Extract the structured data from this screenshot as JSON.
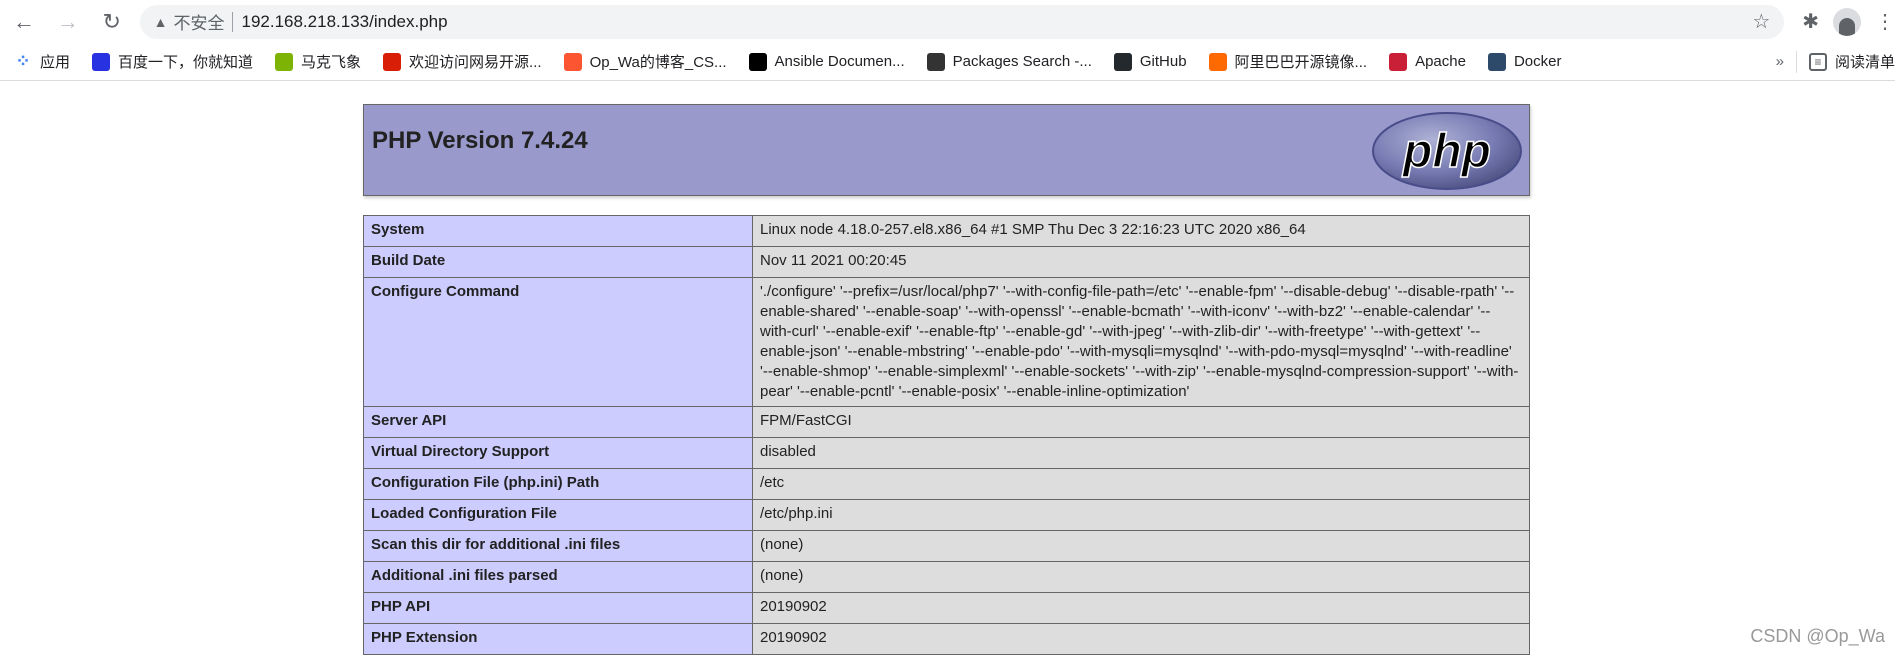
{
  "browser": {
    "url_security": "不安全",
    "url": "192.168.218.133/index.php",
    "bookmarks": [
      {
        "label": "应用",
        "icon": "apps-grid-icon",
        "color": "#4285f4"
      },
      {
        "label": "百度一下，你就知道",
        "icon": "baidu-paw-icon",
        "color": "#2932e1"
      },
      {
        "label": "马克飞象",
        "icon": "maxiang-icon",
        "color": "#7cb305"
      },
      {
        "label": "欢迎访问网易开源...",
        "icon": "netease-icon",
        "color": "#d81e06"
      },
      {
        "label": "Op_Wa的博客_CS...",
        "icon": "csdn-icon",
        "color": "#fc5531"
      },
      {
        "label": "Ansible Documen...",
        "icon": "ansible-icon",
        "color": "#000000"
      },
      {
        "label": "Packages Search -...",
        "icon": "search-icon",
        "color": "#333333"
      },
      {
        "label": "GitHub",
        "icon": "github-icon",
        "color": "#24292e"
      },
      {
        "label": "阿里巴巴开源镜像...",
        "icon": "aliyun-icon",
        "color": "#ff6a00"
      },
      {
        "label": "Apache",
        "icon": "apache-feather-icon",
        "color": "#c92037"
      },
      {
        "label": "Docker",
        "icon": "docker-icon",
        "color": "#2d4a6b"
      }
    ],
    "more": "»",
    "reading_list": "阅读清单"
  },
  "phpinfo": {
    "title": "PHP Version 7.4.24",
    "logo_text": "php",
    "rows": [
      {
        "key": "System",
        "value": "Linux node 4.18.0-257.el8.x86_64 #1 SMP Thu Dec 3 22:16:23 UTC 2020 x86_64"
      },
      {
        "key": "Build Date",
        "value": "Nov 11 2021 00:20:45"
      },
      {
        "key": "Configure Command",
        "value": "'./configure' '--prefix=/usr/local/php7' '--with-config-file-path=/etc' '--enable-fpm' '--disable-debug' '--disable-rpath' '--enable-shared' '--enable-soap' '--with-openssl' '--enable-bcmath' '--with-iconv' '--with-bz2' '--enable-calendar' '--with-curl' '--enable-exif' '--enable-ftp' '--enable-gd' '--with-jpeg' '--with-zlib-dir' '--with-freetype' '--with-gettext' '--enable-json' '--enable-mbstring' '--enable-pdo' '--with-mysqli=mysqlnd' '--with-pdo-mysql=mysqlnd' '--with-readline' '--enable-shmop' '--enable-simplexml' '--enable-sockets' '--with-zip' '--enable-mysqlnd-compression-support' '--with-pear' '--enable-pcntl' '--enable-posix' '--enable-inline-optimization'"
      },
      {
        "key": "Server API",
        "value": "FPM/FastCGI"
      },
      {
        "key": "Virtual Directory Support",
        "value": "disabled"
      },
      {
        "key": "Configuration File (php.ini) Path",
        "value": "/etc"
      },
      {
        "key": "Loaded Configuration File",
        "value": "/etc/php.ini"
      },
      {
        "key": "Scan this dir for additional .ini files",
        "value": "(none)"
      },
      {
        "key": "Additional .ini files parsed",
        "value": "(none)"
      },
      {
        "key": "PHP API",
        "value": "20190902"
      },
      {
        "key": "PHP Extension",
        "value": "20190902"
      }
    ],
    "colors": {
      "header": "#9999cc",
      "key_cell": "#ccccff",
      "value_cell": "#dddddd"
    }
  },
  "watermark": "CSDN @Op_Wa"
}
